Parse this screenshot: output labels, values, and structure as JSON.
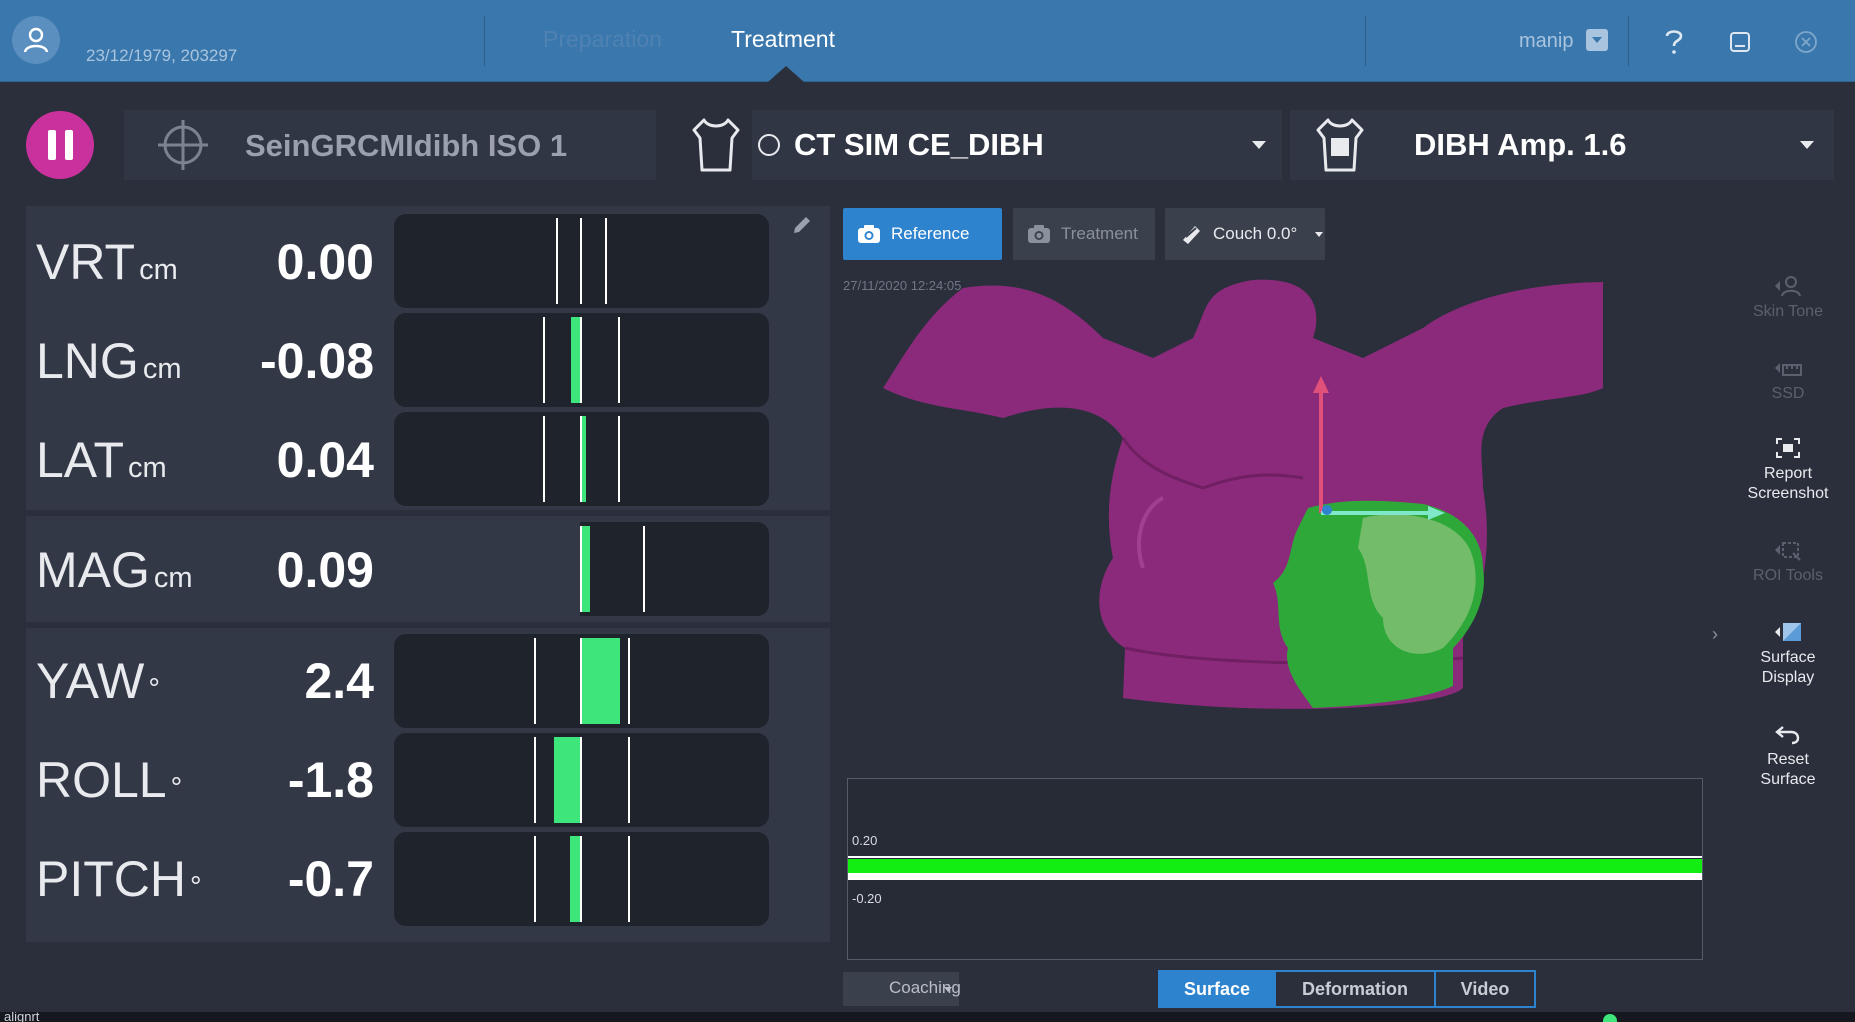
{
  "header": {
    "patient_info": "23/12/1979, 203297",
    "tabs": [
      "Preparation",
      "Treatment"
    ],
    "active_tab": "Treatment",
    "user": "manip"
  },
  "toolbar": {
    "isocenter": "SeinGRCMIdibh ISO 1",
    "reference_surface": "CT SIM CE_DIBH",
    "gating": "DIBH Amp. 1.6"
  },
  "readouts": [
    {
      "axis": "VRT",
      "unit": "cm",
      "value": "0.00",
      "delta": 0.0
    },
    {
      "axis": "LNG",
      "unit": "cm",
      "value": "-0.08",
      "delta": -0.08
    },
    {
      "axis": "LAT",
      "unit": "cm",
      "value": "0.04",
      "delta": 0.04
    },
    {
      "axis": "MAG",
      "unit": "cm",
      "value": "0.09",
      "delta": 0.09
    },
    {
      "axis": "YAW",
      "unit": "°",
      "value": "2.4",
      "delta": 2.4
    },
    {
      "axis": "ROLL",
      "unit": "°",
      "value": "-1.8",
      "delta": -1.8
    },
    {
      "axis": "PITCH",
      "unit": "°",
      "value": "-0.7",
      "delta": -0.7
    }
  ],
  "view": {
    "reference_label": "Reference",
    "treatment_label": "Treatment",
    "couch_label": "Couch 0.0°",
    "timestamp": "27/11/2020 12:24:05"
  },
  "side_tools": [
    "Skin Tone",
    "SSD",
    "Report Screenshot",
    "ROI Tools",
    "Surface Display",
    "Reset Surface"
  ],
  "graph": {
    "upper_label": "0.20",
    "lower_label": "-0.20"
  },
  "bottom": {
    "coaching": "Coaching",
    "modes": [
      "Surface",
      "Deformation",
      "Video"
    ],
    "active_mode": "Surface",
    "status_left": "alignrt"
  },
  "colors": {
    "header_bg": "#3a77ad",
    "pause": "#c9329c",
    "in_tolerance": "#3ee57a",
    "accent": "#2e83cf",
    "body_surface": "#8b2a7a"
  }
}
